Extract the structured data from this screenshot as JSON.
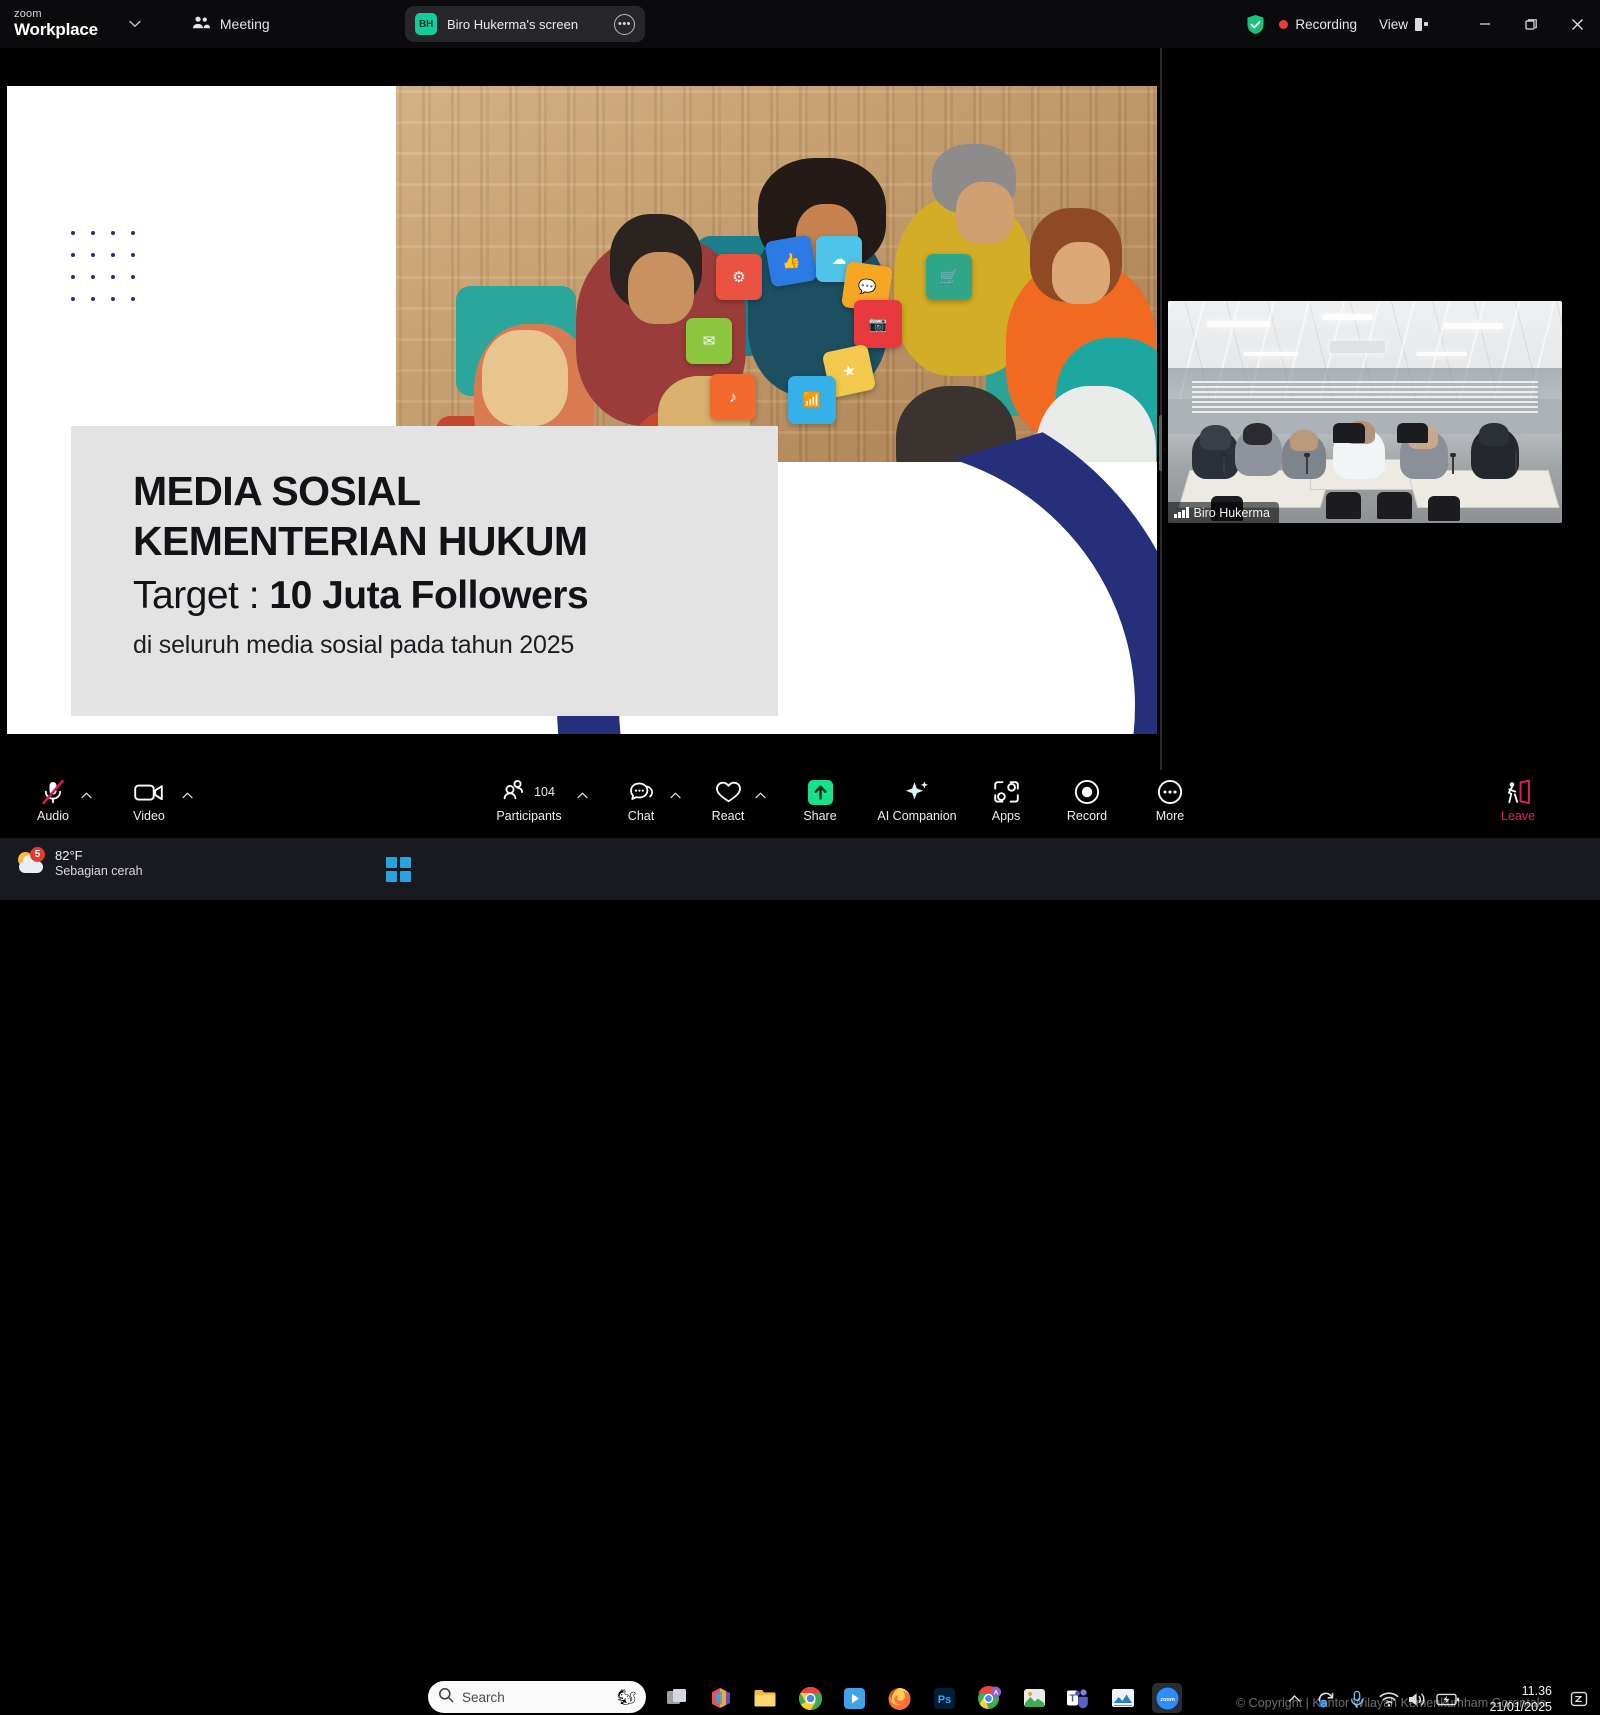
{
  "titlebar": {
    "brand_top": "zoom",
    "brand_bottom": "Workplace",
    "caret_icon": "chevron-down-icon",
    "meeting_label": "Meeting",
    "meeting_icon": "people-icon",
    "share_pill": {
      "avatar_initials": "BH",
      "label": "Biro Hukerma's screen",
      "more_icon": "more-options-icon"
    },
    "security_icon": "shield-check-icon",
    "recording_label": "Recording",
    "view_label": "View",
    "view_icon": "layout-icon",
    "minimize_icon": "minimize-icon",
    "restore_icon": "restore-icon",
    "close_icon": "close-icon"
  },
  "slide": {
    "heading_line1": "MEDIA SOSIAL",
    "heading_line2": "KEMENTERIAN HUKUM",
    "target_prefix": "Target : ",
    "target_value": "10 Juta Followers",
    "subtitle": "di seluruh media sosial pada tahun 2025",
    "colors": {
      "navy": "#26307a",
      "yellow": "#f6c400",
      "card_bg": "#e3e3e3"
    }
  },
  "video_tile": {
    "name": "Biro Hukerma",
    "signal_icon": "signal-bars-icon"
  },
  "toolbar": {
    "items": [
      {
        "label": "Audio",
        "icon": "microphone-muted-icon",
        "has_caret": true
      },
      {
        "label": "Video",
        "icon": "camera-icon",
        "has_caret": true
      },
      {
        "label": "Participants",
        "icon": "participants-icon",
        "count": "104",
        "has_caret": true
      },
      {
        "label": "Chat",
        "icon": "chat-icon",
        "has_caret": true
      },
      {
        "label": "React",
        "icon": "heart-icon",
        "has_caret": true
      },
      {
        "label": "Share",
        "icon": "share-screen-icon",
        "has_caret": false
      },
      {
        "label": "AI Companion",
        "icon": "sparkle-icon",
        "has_caret": false
      },
      {
        "label": "Apps",
        "icon": "apps-icon",
        "has_caret": false
      },
      {
        "label": "Record",
        "icon": "record-icon",
        "has_caret": false
      },
      {
        "label": "More",
        "icon": "more-icon",
        "has_caret": false
      }
    ],
    "leave": {
      "label": "Leave",
      "icon": "leave-meeting-icon"
    }
  },
  "taskbar": {
    "weather": {
      "temperature": "82°F",
      "condition": "Sebagian cerah",
      "badge": "5",
      "icon": "sun-cloud-icon"
    },
    "start_icon": "windows-start-icon",
    "search": {
      "placeholder": "Search",
      "icon": "search-icon"
    },
    "apps": [
      {
        "name": "task-view-icon"
      },
      {
        "name": "office-icon"
      },
      {
        "name": "file-explorer-icon"
      },
      {
        "name": "chrome-icon"
      },
      {
        "name": "media-player-icon"
      },
      {
        "name": "firefox-icon"
      },
      {
        "name": "photoshop-icon"
      },
      {
        "name": "chrome-profile-icon"
      },
      {
        "name": "photos-icon"
      },
      {
        "name": "teams-icon"
      },
      {
        "name": "excel-chart-icon"
      },
      {
        "name": "zoom-icon"
      }
    ],
    "tray": {
      "overflow_icon": "chevron-up-icon",
      "sync_icon": "onedrive-sync-icon",
      "mic_icon": "microphone-icon",
      "wifi_icon": "wifi-icon",
      "volume_icon": "volume-icon",
      "battery_icon": "battery-charging-icon"
    },
    "clock": {
      "time": "11.36",
      "date": "21/01/2025"
    },
    "notification_icon": "notification-bell-icon",
    "watermark": "© Copyright | Kantor Wilayah Kemenkumham Gorontalo"
  }
}
